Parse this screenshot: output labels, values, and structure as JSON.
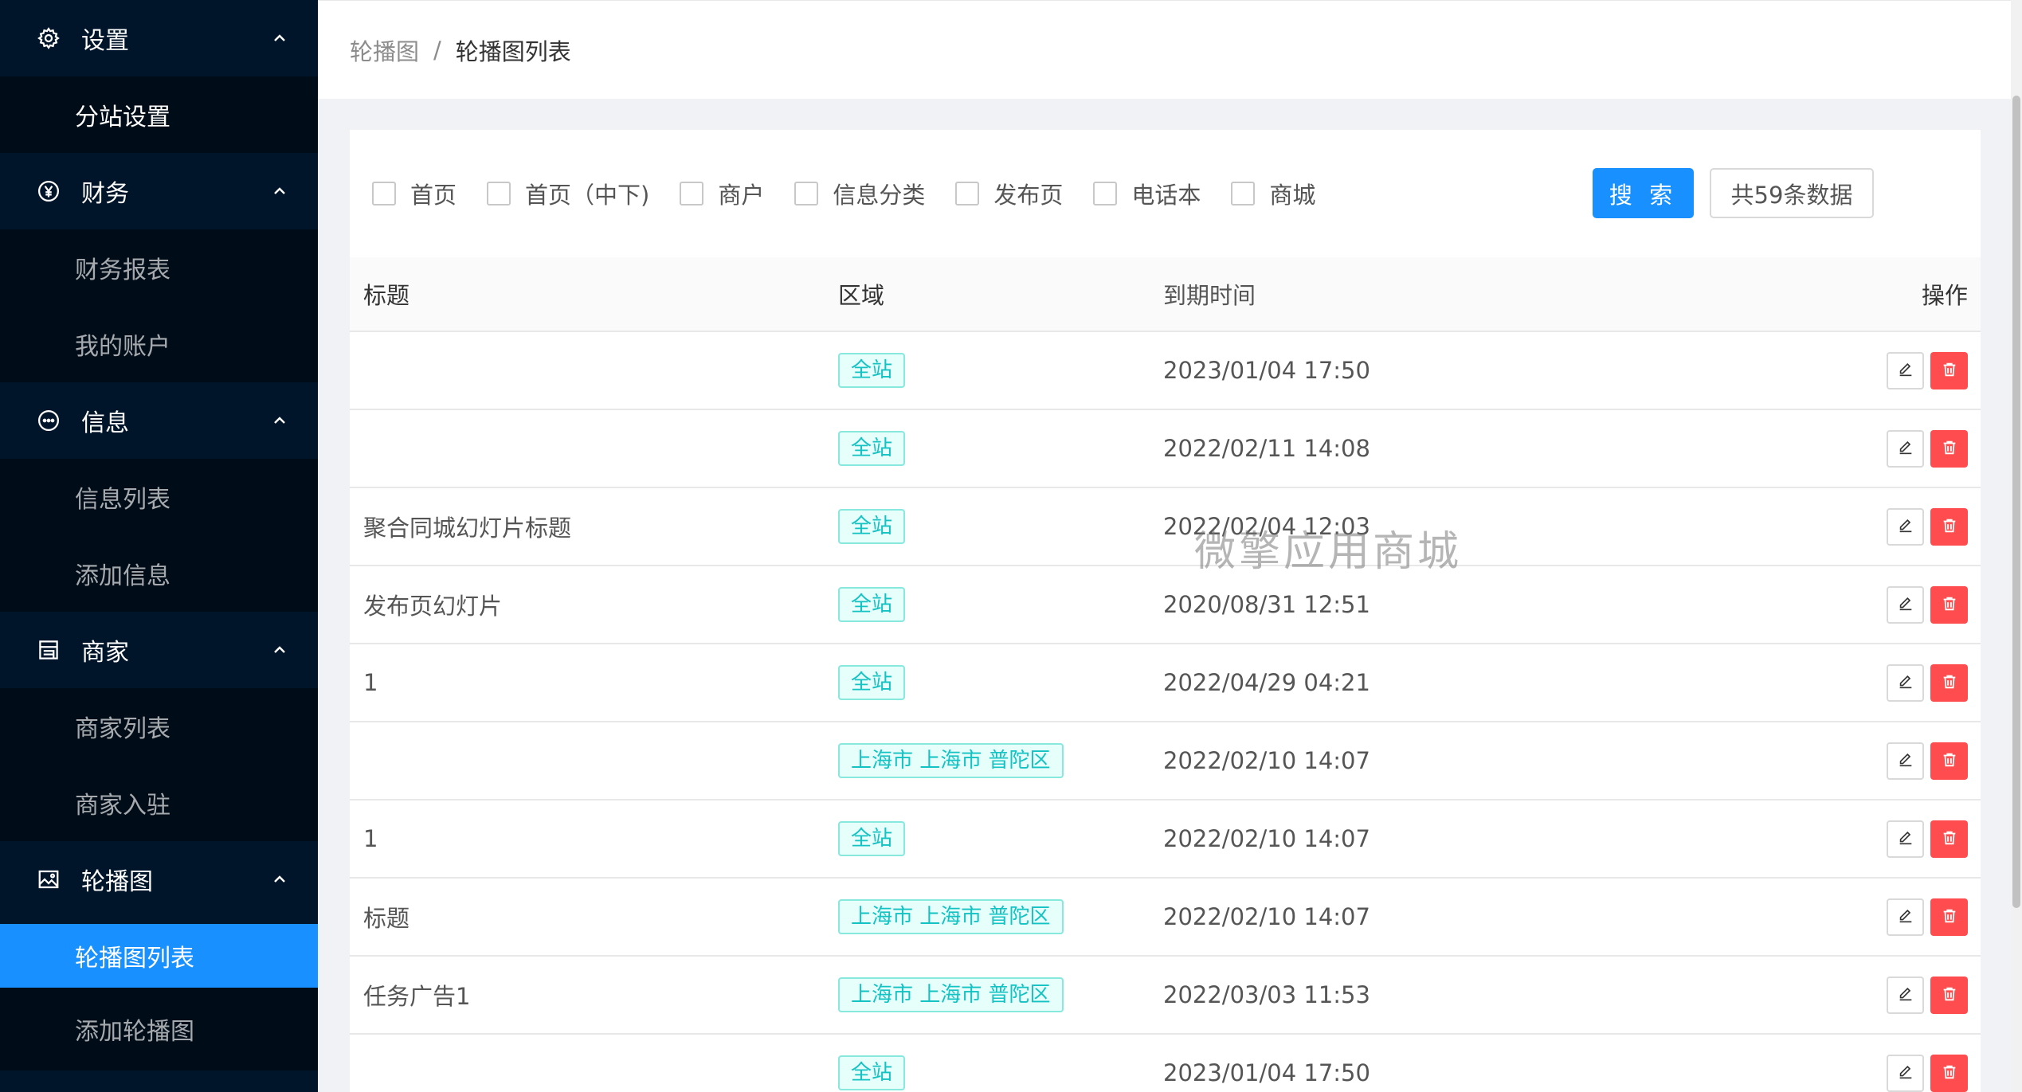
{
  "sidebar": {
    "groups": [
      {
        "label": "设置",
        "icon": "gear-icon",
        "items": [
          {
            "label": "分站设置"
          }
        ]
      },
      {
        "label": "财务",
        "icon": "yen-circle-icon",
        "items": [
          {
            "label": "财务报表"
          },
          {
            "label": "我的账户"
          }
        ]
      },
      {
        "label": "信息",
        "icon": "chat-bubble-icon",
        "items": [
          {
            "label": "信息列表"
          },
          {
            "label": "添加信息"
          }
        ]
      },
      {
        "label": "商家",
        "icon": "shop-icon",
        "items": [
          {
            "label": "商家列表"
          },
          {
            "label": "商家入驻"
          }
        ]
      },
      {
        "label": "轮播图",
        "icon": "picture-icon",
        "items": [
          {
            "label": "轮播图列表",
            "active": true
          },
          {
            "label": "添加轮播图"
          }
        ]
      }
    ]
  },
  "breadcrumb": {
    "parent": "轮播图",
    "separator": "/",
    "current": "轮播图列表"
  },
  "filters": {
    "checkboxes": [
      "首页",
      "首页（中下)",
      "商户",
      "信息分类",
      "发布页",
      "电话本",
      "商城"
    ],
    "search_label": "搜 索",
    "count_label": "共59条数据"
  },
  "table": {
    "headers": {
      "title": "标题",
      "region": "区域",
      "expire": "到期时间",
      "op": "操作"
    },
    "rows": [
      {
        "title": "",
        "region": "全站",
        "expire": "2023/01/04 17:50"
      },
      {
        "title": "",
        "region": "全站",
        "expire": "2022/02/11 14:08"
      },
      {
        "title": "聚合同城幻灯片标题",
        "region": "全站",
        "expire": "2022/02/04 12:03"
      },
      {
        "title": "发布页幻灯片",
        "region": "全站",
        "expire": "2020/08/31 12:51"
      },
      {
        "title": "1",
        "region": "全站",
        "expire": "2022/04/29 04:21"
      },
      {
        "title": "",
        "region": "上海市 上海市 普陀区",
        "expire": "2022/02/10 14:07"
      },
      {
        "title": "1",
        "region": "全站",
        "expire": "2022/02/10 14:07"
      },
      {
        "title": "标题",
        "region": "上海市 上海市 普陀区",
        "expire": "2022/02/10 14:07"
      },
      {
        "title": "任务广告1",
        "region": "上海市 上海市 普陀区",
        "expire": "2022/03/03 11:53"
      },
      {
        "title": "",
        "region": "全站",
        "expire": "2023/01/04 17:50"
      }
    ]
  },
  "watermark": "微擎应用商城",
  "colors": {
    "sidebar_bg": "#001529",
    "submenu_bg": "#000c17",
    "accent": "#1890ff",
    "danger": "#ff4d4f",
    "tag": "#13c2c2"
  }
}
